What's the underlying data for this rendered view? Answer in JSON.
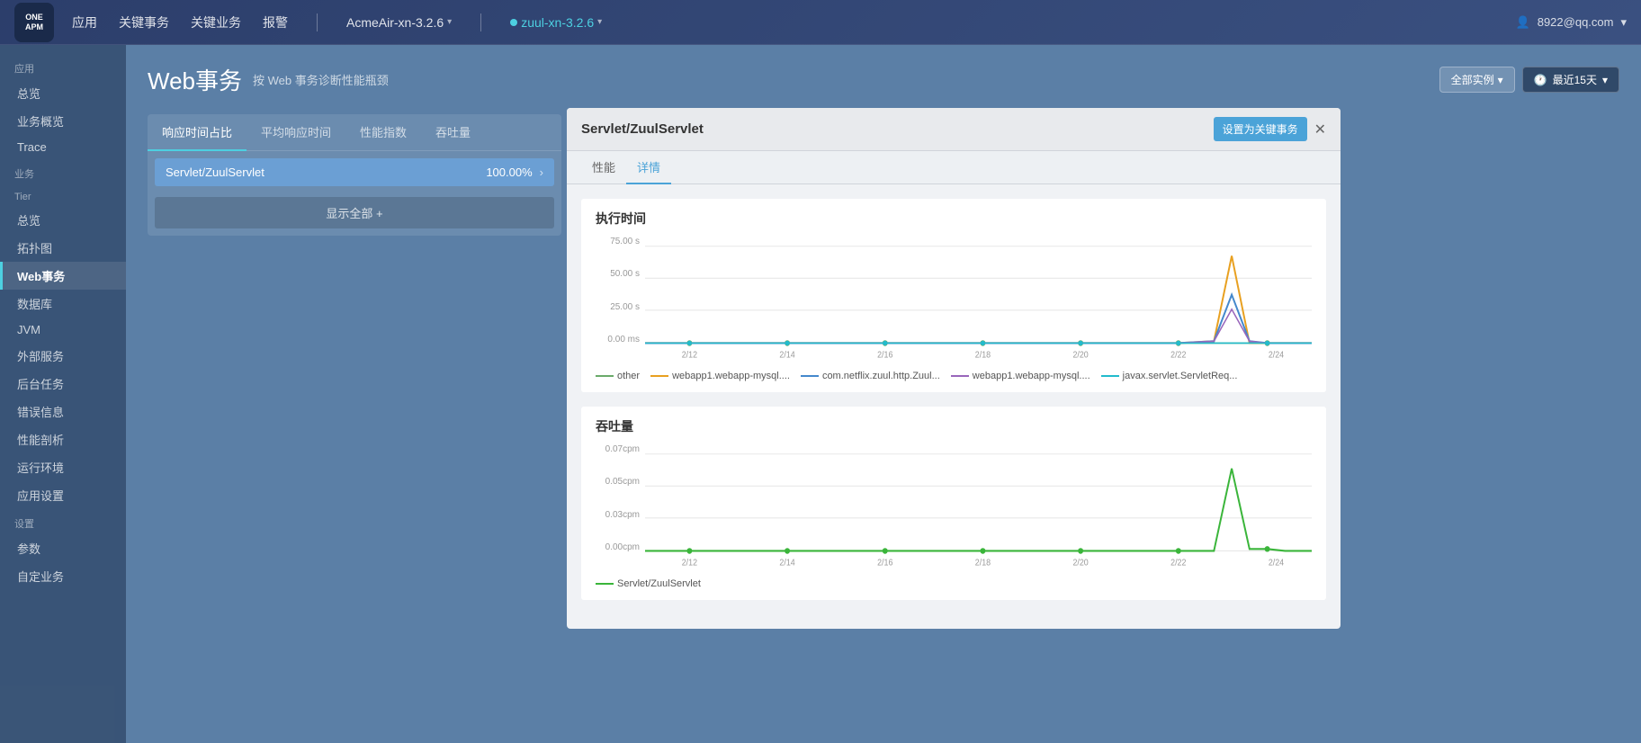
{
  "topNav": {
    "logo": {
      "line1": "ONE",
      "line2": "APM"
    },
    "links": [
      "应用",
      "关键事务",
      "关键业务",
      "报警"
    ],
    "apps": [
      {
        "label": "AcmeAir-xn-3.2.6",
        "active": false
      },
      {
        "label": "zuul-xn-3.2.6",
        "active": true
      }
    ],
    "user": "8922@qq.com"
  },
  "sidebar": {
    "sections": [
      {
        "label": "应用",
        "items": [
          {
            "label": "总览",
            "active": false
          },
          {
            "label": "业务概览",
            "active": false
          },
          {
            "label": "Trace",
            "active": false
          }
        ]
      },
      {
        "label": "业务",
        "items": []
      },
      {
        "label": "Tier",
        "items": [
          {
            "label": "总览",
            "active": false
          },
          {
            "label": "拓扑图",
            "active": false
          },
          {
            "label": "Web事务",
            "active": true
          },
          {
            "label": "数据库",
            "active": false
          },
          {
            "label": "JVM",
            "active": false
          },
          {
            "label": "外部服务",
            "active": false
          },
          {
            "label": "后台任务",
            "active": false
          },
          {
            "label": "错误信息",
            "active": false
          },
          {
            "label": "性能剖析",
            "active": false
          },
          {
            "label": "运行环境",
            "active": false
          },
          {
            "label": "应用设置",
            "active": false
          }
        ]
      },
      {
        "label": "设置",
        "items": [
          {
            "label": "参数",
            "active": false
          },
          {
            "label": "自定业务",
            "active": false
          }
        ]
      }
    ]
  },
  "page": {
    "title": "Web事务",
    "subtitle": "按 Web 事务诊断性能瓶颈",
    "filters": {
      "instance": "全部实例",
      "time": "最近15天"
    }
  },
  "tabs": {
    "items": [
      "响应时间占比",
      "平均响应时间",
      "性能指数",
      "吞吐量"
    ],
    "active": 0
  },
  "servletList": {
    "items": [
      {
        "name": "Servlet/ZuulServlet",
        "pct": "100.00%"
      }
    ],
    "showAllLabel": "显示全部 +"
  },
  "detailPanel": {
    "title": "Servlet/ZuulServlet",
    "btnKey": "设置为关键事务",
    "tabs": [
      "性能",
      "详情"
    ],
    "activeTab": 1,
    "execTime": {
      "title": "执行时间",
      "yLabels": [
        "75.00 s",
        "50.00 s",
        "25.00 s",
        "0.00 ms"
      ],
      "xLabels": [
        "2/12",
        "2/14",
        "2/16",
        "2/18",
        "2/20",
        "2/22",
        "2/24"
      ],
      "legend": [
        {
          "label": "other",
          "color": "#6aaa6a",
          "type": "line"
        },
        {
          "label": "webapp1.webapp-mysql....",
          "color": "#e8a020",
          "type": "line"
        },
        {
          "label": "com.netflix.zuul.http.Zuul...",
          "color": "#4488cc",
          "type": "line"
        },
        {
          "label": "webapp1.webapp-mysql....",
          "color": "#9966bb",
          "type": "line"
        },
        {
          "label": "javax.servlet.ServletReq...",
          "color": "#22bbcc",
          "type": "line"
        }
      ]
    },
    "throughput": {
      "title": "吞吐量",
      "yLabels": [
        "0.07cpm",
        "0.05cpm",
        "0.03cpm",
        "0.00cpm"
      ],
      "xLabels": [
        "2/12",
        "2/14",
        "2/16",
        "2/18",
        "2/20",
        "2/22",
        "2/24"
      ],
      "legend": [
        {
          "label": "Servlet/ZuulServlet",
          "color": "#3ab53a",
          "type": "line"
        }
      ]
    }
  }
}
